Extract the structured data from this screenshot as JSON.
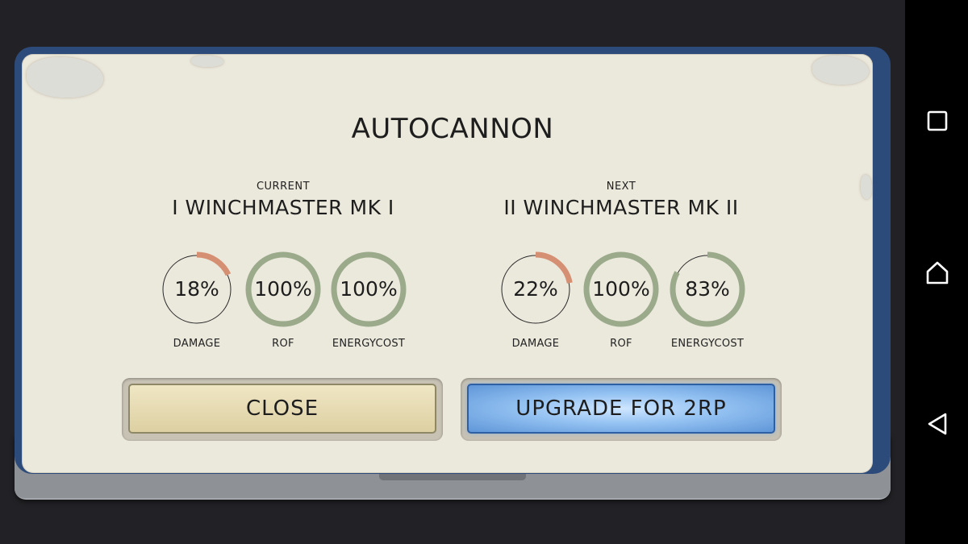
{
  "dialog": {
    "title": "AUTOCANNON"
  },
  "current": {
    "tag": "CURRENT",
    "name": "I WINCHMASTER MK I",
    "stats": [
      {
        "value": "18%",
        "label": "DAMAGE",
        "fraction": 0.18,
        "color": "#d58f72"
      },
      {
        "value": "100%",
        "label": "ROF",
        "fraction": 1.0,
        "color": "#9aaa8a"
      },
      {
        "value": "100%",
        "label": "ENERGYCOST",
        "fraction": 1.0,
        "color": "#9aaa8a"
      }
    ]
  },
  "next": {
    "tag": "NEXT",
    "name": "II WINCHMASTER MK II",
    "stats": [
      {
        "value": "22%",
        "label": "DAMAGE",
        "fraction": 0.22,
        "color": "#d58f72"
      },
      {
        "value": "100%",
        "label": "ROF",
        "fraction": 1.0,
        "color": "#9aaa8a"
      },
      {
        "value": "83%",
        "label": "ENERGYCOST",
        "fraction": 0.83,
        "color": "#9aaa8a"
      }
    ]
  },
  "buttons": {
    "close_label": "CLOSE",
    "upgrade_label": "UPGRADE FOR 2RP"
  },
  "navbar": {
    "icons": [
      "recents-icon",
      "home-icon",
      "back-icon"
    ]
  }
}
